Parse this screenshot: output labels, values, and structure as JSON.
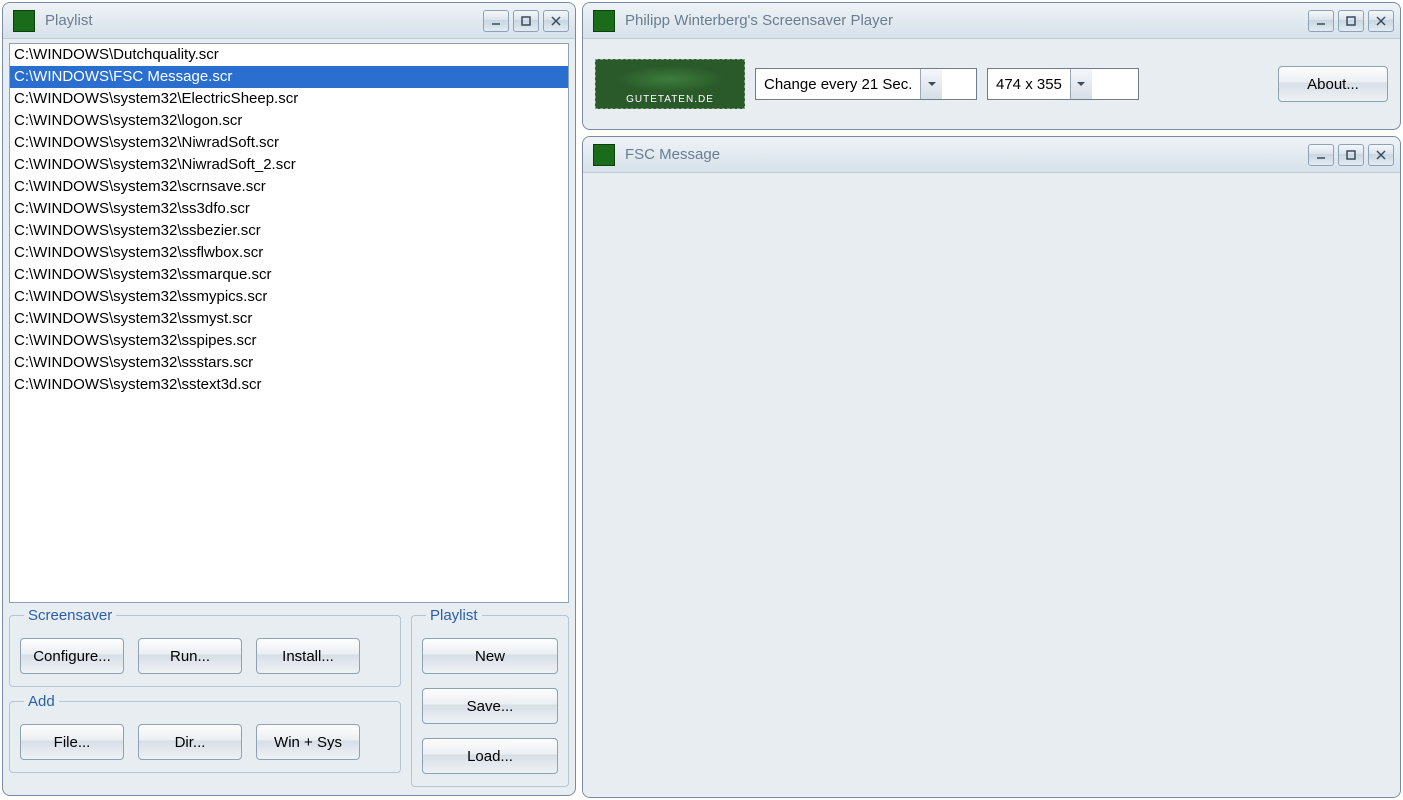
{
  "playlist_window": {
    "title": "Playlist",
    "items": [
      {
        "path": "C:\\WINDOWS\\Dutchquality.scr",
        "selected": false
      },
      {
        "path": "C:\\WINDOWS\\FSC Message.scr",
        "selected": true
      },
      {
        "path": "C:\\WINDOWS\\system32\\ElectricSheep.scr",
        "selected": false
      },
      {
        "path": "C:\\WINDOWS\\system32\\logon.scr",
        "selected": false
      },
      {
        "path": "C:\\WINDOWS\\system32\\NiwradSoft.scr",
        "selected": false
      },
      {
        "path": "C:\\WINDOWS\\system32\\NiwradSoft_2.scr",
        "selected": false
      },
      {
        "path": "C:\\WINDOWS\\system32\\scrnsave.scr",
        "selected": false
      },
      {
        "path": "C:\\WINDOWS\\system32\\ss3dfo.scr",
        "selected": false
      },
      {
        "path": "C:\\WINDOWS\\system32\\ssbezier.scr",
        "selected": false
      },
      {
        "path": "C:\\WINDOWS\\system32\\ssflwbox.scr",
        "selected": false
      },
      {
        "path": "C:\\WINDOWS\\system32\\ssmarque.scr",
        "selected": false
      },
      {
        "path": "C:\\WINDOWS\\system32\\ssmypics.scr",
        "selected": false
      },
      {
        "path": "C:\\WINDOWS\\system32\\ssmyst.scr",
        "selected": false
      },
      {
        "path": "C:\\WINDOWS\\system32\\sspipes.scr",
        "selected": false
      },
      {
        "path": "C:\\WINDOWS\\system32\\ssstars.scr",
        "selected": false
      },
      {
        "path": "C:\\WINDOWS\\system32\\sstext3d.scr",
        "selected": false
      }
    ],
    "groups": {
      "screensaver": {
        "legend": "Screensaver",
        "configure": "Configure...",
        "run": "Run...",
        "install": "Install..."
      },
      "add": {
        "legend": "Add",
        "file": "File...",
        "dir": "Dir...",
        "winsys": "Win + Sys"
      },
      "playlist": {
        "legend": "Playlist",
        "new": "New",
        "save": "Save...",
        "load": "Load..."
      }
    }
  },
  "player_window": {
    "title": "Philipp Winterberg's Screensaver Player",
    "logo_text": "GUTETATEN.DE",
    "change_dropdown": "Change every 21 Sec.",
    "resolution_dropdown": "474 x 355",
    "about": "About..."
  },
  "preview_window": {
    "title": "FSC Message"
  }
}
